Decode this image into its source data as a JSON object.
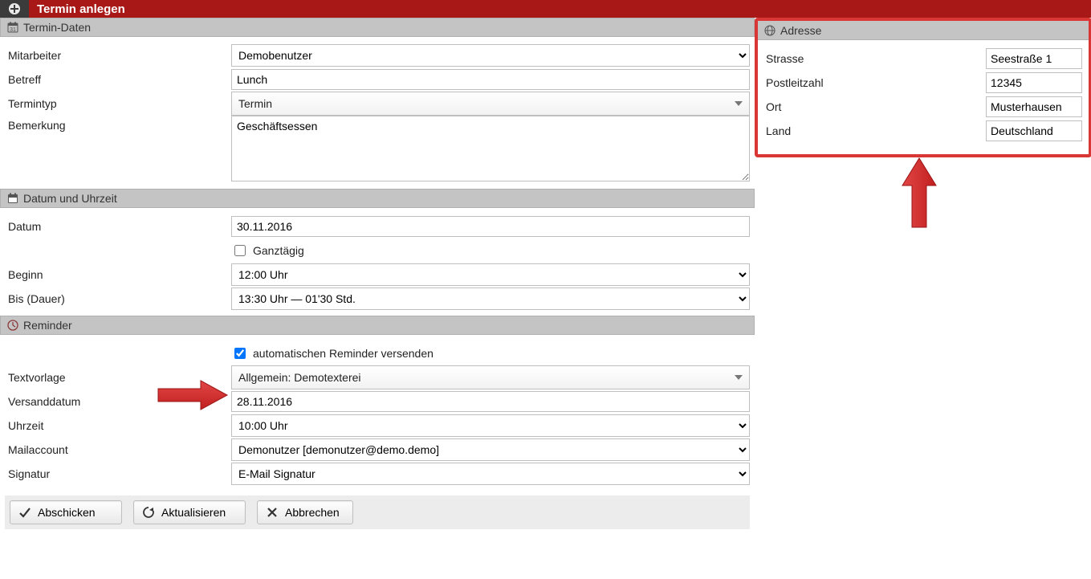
{
  "titlebar": {
    "title": "Termin anlegen"
  },
  "sections": {
    "terminDaten": "Termin-Daten",
    "datumUhrzeit": "Datum und Uhrzeit",
    "reminder": "Reminder",
    "adresse": "Adresse"
  },
  "labels": {
    "mitarbeiter": "Mitarbeiter",
    "betreff": "Betreff",
    "termintyp": "Termintyp",
    "bemerkung": "Bemerkung",
    "datum": "Datum",
    "ganztaegig": "Ganztägig",
    "beginn": "Beginn",
    "bis": "Bis (Dauer)",
    "reminderAuto": "automatischen Reminder versenden",
    "textvorlage": "Textvorlage",
    "versanddatum": "Versanddatum",
    "uhrzeit": "Uhrzeit",
    "mailaccount": "Mailaccount",
    "signatur": "Signatur",
    "strasse": "Strasse",
    "postleitzahl": "Postleitzahl",
    "ort": "Ort",
    "land": "Land"
  },
  "values": {
    "mitarbeiter": "Demobenutzer",
    "betreff": "Lunch",
    "termintyp": "Termin",
    "bemerkung": "Geschäftsessen",
    "datum": "30.11.2016",
    "ganztaegig": false,
    "beginn": "12:00 Uhr",
    "bis": "13:30 Uhr — 01'30 Std.",
    "reminderAuto": true,
    "textvorlage": "Allgemein: Demotexterei",
    "versanddatum": "28.11.2016",
    "uhrzeit": "10:00 Uhr",
    "mailaccount": "Demonutzer [demonutzer@demo.demo]",
    "signatur": "E-Mail Signatur",
    "strasse": "Seestraße 1",
    "postleitzahl": "12345",
    "ort": "Musterhausen",
    "land": "Deutschland"
  },
  "buttons": {
    "abschicken": "Abschicken",
    "aktualisieren": "Aktualisieren",
    "abbrechen": "Abbrechen"
  }
}
